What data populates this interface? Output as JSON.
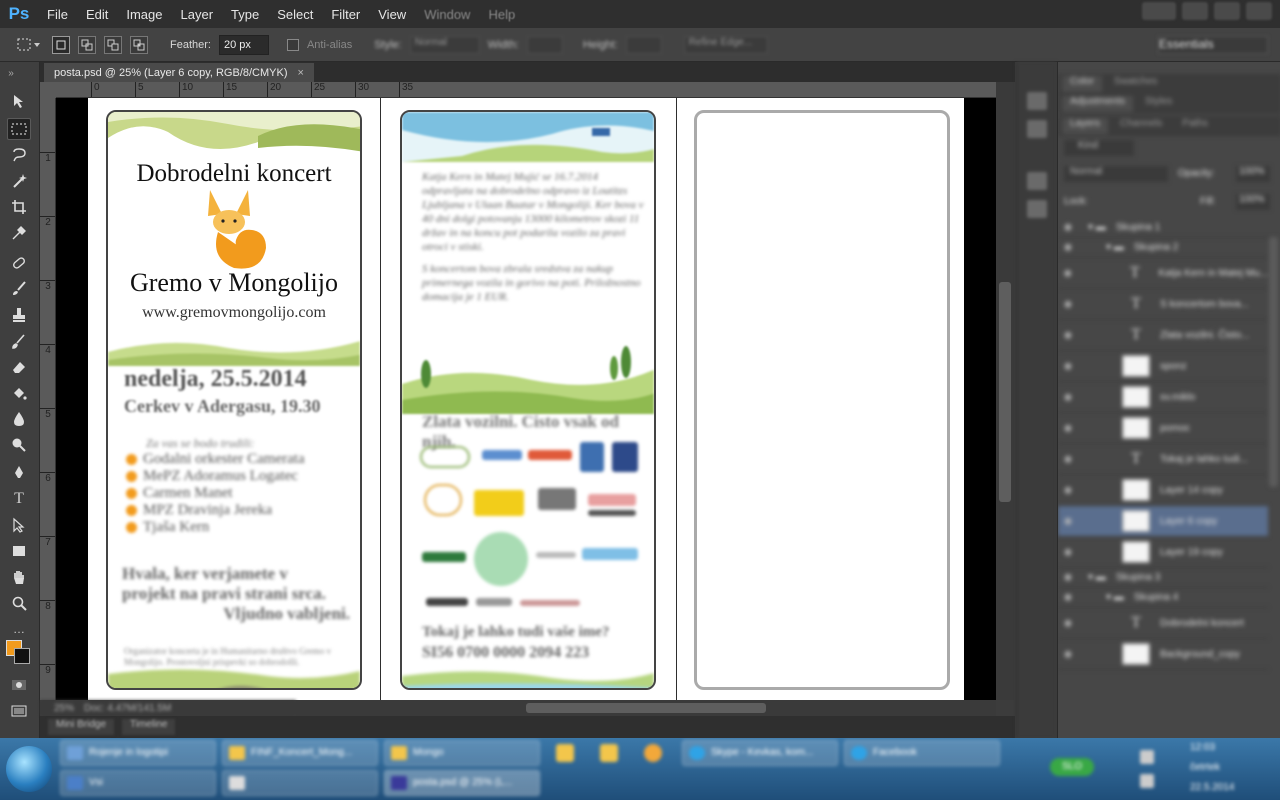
{
  "app": {
    "logo": "Ps"
  },
  "menu": [
    "File",
    "Edit",
    "Image",
    "Layer",
    "Type",
    "Select",
    "Filter",
    "View",
    "Window",
    "Help"
  ],
  "options": {
    "feather_label": "Feather:",
    "feather_value": "20 px",
    "antialias_label": "Anti-alias",
    "style_label": "Style:",
    "style_value": "Normal",
    "width_label": "Width:",
    "height_label": "Height:",
    "refine_label": "Refine Edge...",
    "workspace": "Essentials"
  },
  "document": {
    "tab_title": "posta.psd @ 25% (Layer 6 copy, RGB/8/CMYK)",
    "close_glyph": "×",
    "zoom": "25%",
    "doc_info": "Doc: 4.47M/141.5M"
  },
  "ruler": {
    "top": [
      "0",
      "5",
      "10",
      "15",
      "20",
      "25",
      "30",
      "35"
    ],
    "left": [
      "1",
      "2",
      "3",
      "4",
      "5",
      "6",
      "7",
      "8",
      "9"
    ]
  },
  "flyer": {
    "left": {
      "title": "Dobrodelni koncert",
      "subtitle": "Gremo v Mongolijo",
      "url": "www.gremovmongolijo.com",
      "date": "nedelja, 25.5.2014",
      "place": "Cerkev v Adergasu, 19.30",
      "performers_intro": "Za vas se bodo trudili:",
      "performers": [
        "Godalni orkester Camerata",
        "MePZ Adoramus Logatec",
        "Carmen Manet",
        "MPZ Dravinja Jereka",
        "Tjaša Kern"
      ],
      "thanks": [
        "Hvala, ker verjamete v",
        "projekt na pravi strani srca.",
        "Vljudno vabljeni."
      ],
      "footnote": "Organizator koncerta je in Humanitarno društvo Gremo v Mongolijo. Prostovoljni prispevki so dobrodošli."
    },
    "middle": {
      "para1": "Katja Kern in Matej Mujić se 16.7.2014 odpravljata na dobrodelno odpravo iz Loutitzs Ljubljana v Ulaan Baatar v Mongoliji. Ker bova v 40 dni dolgi potovanju 13000 kilometrov skozi 11 držav in na koncu pot podarila vozilo za pravi otroci v stiski.",
      "para2": "S koncertom bova zbrala sredstva za nakup primernega vozila in gorivo na poti. Priložnostno domacija je 1 EUR.",
      "slogan": "Zlata vozilni. Cisto vsak od njih.",
      "question": "Tokaj je lahko tudi vaše ime?",
      "account": "SI56 0700 0000 2094 223"
    }
  },
  "layers": {
    "tabs_top": [
      "Color",
      "Swatches"
    ],
    "tabs_mid": [
      "Adjustments",
      "Styles"
    ],
    "tabs_layers": [
      "Layers",
      "Channels",
      "Paths"
    ],
    "kind": "Kind",
    "blend": "Normal",
    "opacity_label": "Opacity:",
    "opacity": "100%",
    "lock_label": "Lock:",
    "fill_label": "Fill:",
    "fill": "100%",
    "rows": [
      {
        "name": "Skupina 1",
        "type": "group"
      },
      {
        "name": "Skupina 2",
        "type": "group"
      },
      {
        "name": "Katja Kern in Matej Mu...",
        "type": "text"
      },
      {
        "name": "S koncertom bova...",
        "type": "text"
      },
      {
        "name": "Zlata vozilni. Čisto...",
        "type": "text"
      },
      {
        "name": "sponz",
        "type": "image"
      },
      {
        "name": "sv.miklo",
        "type": "image"
      },
      {
        "name": "pomoc",
        "type": "image"
      },
      {
        "name": "Tokaj je lahko tudi...",
        "type": "text"
      },
      {
        "name": "Layer 14 copy",
        "type": "image"
      },
      {
        "name": "Layer 6 copy",
        "type": "image",
        "selected": true
      },
      {
        "name": "Layer 19 copy",
        "type": "image"
      },
      {
        "name": "Skupina 3",
        "type": "group"
      },
      {
        "name": "Skupina 4",
        "type": "group"
      },
      {
        "name": "Dobrodelni koncert",
        "type": "text"
      },
      {
        "name": "Background_copy",
        "type": "image"
      }
    ]
  },
  "bottom_tabs": [
    "Mini Bridge",
    "Timeline"
  ],
  "taskbar": {
    "tasks_row1": [
      "Rojenje in logotipi",
      "FINF_Koncert_Mong...",
      "Mongo",
      "Skype - Kevkas, kom...",
      "Facebook"
    ],
    "tasks_row2": [
      "Vsi",
      "",
      "posta.psd @ 25% (L..."
    ],
    "tray_time": "12:03",
    "tray_day": "četrtek",
    "tray_date": "22.5.2014",
    "tray_badge": "SLO"
  },
  "colors": {
    "accent_orange": "#f29b1d",
    "selection_blue": "#5a6e8e",
    "ps_blue": "#4fb3ff"
  }
}
